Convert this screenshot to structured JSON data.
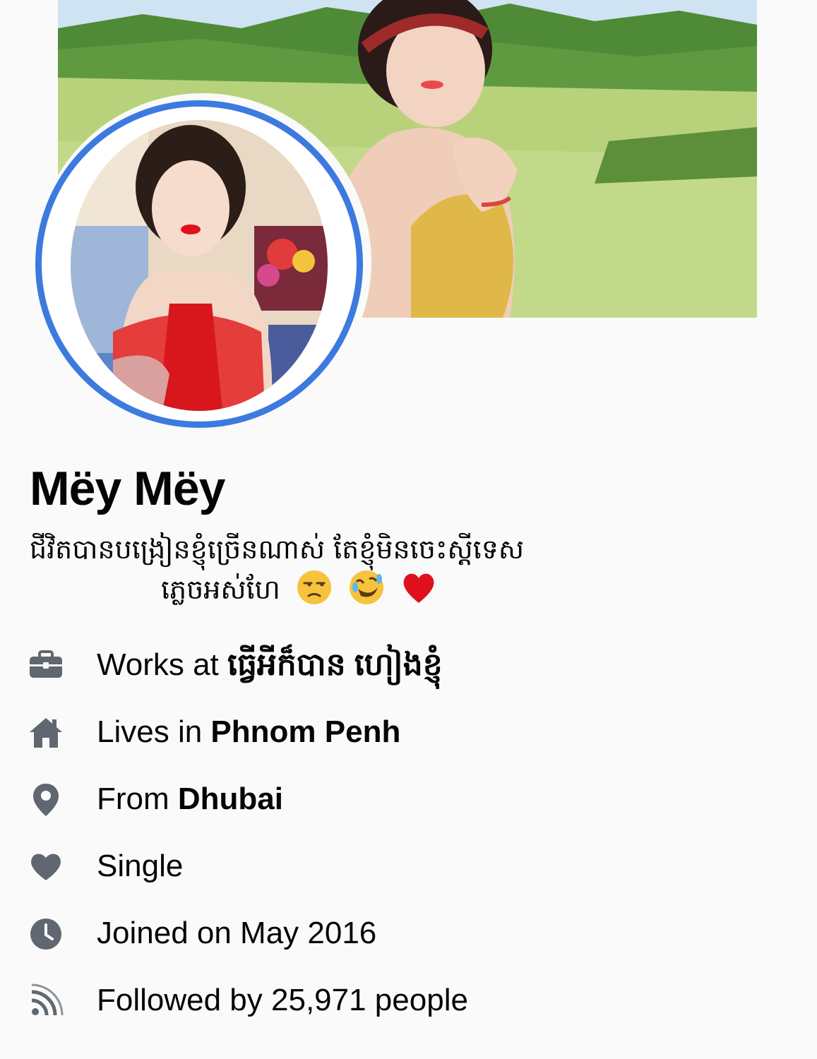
{
  "profile": {
    "name": "Mëy Mëy",
    "bio_line1": "ជីវិតបានបង្រៀនខ្ញុំច្រើនណាស់ តែខ្ញុំមិនចេះស្ដីទេស",
    "bio_line2": "ភ្លេចអស់ហែ",
    "bio_emojis": [
      "unamused-face",
      "rolling-on-floor-laughing",
      "red-heart"
    ]
  },
  "details": [
    {
      "icon": "briefcase-icon",
      "prefix": "Works at ",
      "value": "ធ្វើអីក៏បាន ហៀងខ្ញុំ"
    },
    {
      "icon": "home-icon",
      "prefix": "Lives in ",
      "value": "Phnom Penh"
    },
    {
      "icon": "location-pin-icon",
      "prefix": "From ",
      "value": "Dhubai"
    },
    {
      "icon": "heart-icon",
      "prefix": "Single",
      "value": ""
    },
    {
      "icon": "clock-icon",
      "prefix": "Joined on May 2016",
      "value": ""
    },
    {
      "icon": "rss-feed-icon",
      "prefix": "Followed by 25,971 people",
      "value": ""
    }
  ],
  "colors": {
    "avatar_ring": "#3c7ae0",
    "icon_gray": "#606770",
    "text": "#050505"
  }
}
